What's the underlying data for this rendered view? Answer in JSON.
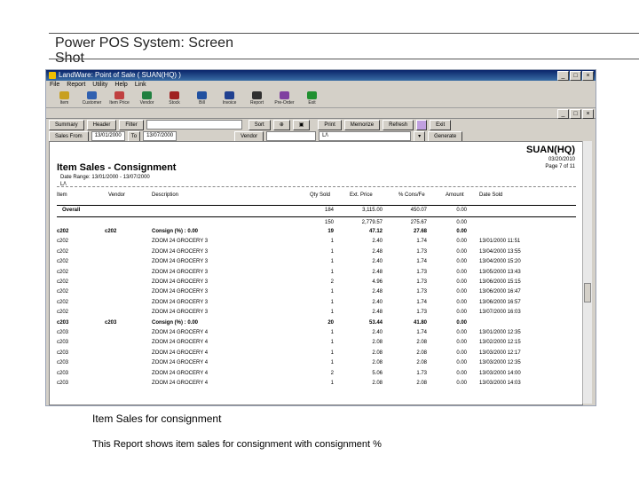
{
  "slide": {
    "title_line1": "Power POS System: Screen",
    "title_line2": "Shot",
    "caption_title": "Item Sales for consignment",
    "caption_desc": "This Report shows item sales for consignment with consignment %"
  },
  "window": {
    "title": "LandWare: Point of Sale ( SUAN(HQ) )",
    "minimize": "_",
    "maximize": "□",
    "close": "×"
  },
  "menu": [
    "File",
    "Report",
    "Utility",
    "Help",
    "Link"
  ],
  "toolbar": [
    {
      "label": "Item",
      "color": "#c8a020"
    },
    {
      "label": "Customer",
      "color": "#3060b0"
    },
    {
      "label": "Item Price",
      "color": "#c04040"
    },
    {
      "label": "Vendor",
      "color": "#208040"
    },
    {
      "label": "Stock",
      "color": "#a02020"
    },
    {
      "label": "Bill",
      "color": "#2050a0"
    },
    {
      "label": "Invoice",
      "color": "#204090"
    },
    {
      "label": "Report",
      "color": "#303030"
    },
    {
      "label": "Pre-Order",
      "color": "#8040a0"
    },
    {
      "label": "Exit",
      "color": "#209030"
    }
  ],
  "controls": {
    "summary": "Summary",
    "header": "Header",
    "filter": "Filter",
    "sort": "Sort",
    "print": "Print",
    "memorize": "Memorize",
    "refresh": "Refresh",
    "exit": "Exit",
    "sales_from_label": "Sales From",
    "date_from": "13/01/2000",
    "to_label": "To",
    "date_to": "13/07/2000",
    "vendor_label": "Vendor",
    "location": "L/\\",
    "generate": "Generate"
  },
  "report": {
    "title": "Item Sales - Consignment",
    "date_range": "Date Range: 13/01/2000 - 13/07/2000",
    "location": "L/\\",
    "store": "SUAN(HQ)",
    "print_date": "03/20/2010",
    "page": "Page 7 of 11",
    "headers": {
      "item": "Item",
      "vendor": "Vendor",
      "description": "Description",
      "qty": "Qty Sold",
      "price": "Ext. Price",
      "cons": "% Cons/Fe",
      "amount": "Amount",
      "date": "Date Sold"
    },
    "overall": {
      "label": "Overall",
      "qty": "184",
      "price": "3,115.00",
      "cons": "450.07",
      "amount": "0.00"
    },
    "subtotal": {
      "qty": "150",
      "price": "2,779.57",
      "cons": "275.67",
      "amount": "0.00"
    },
    "rows": [
      {
        "item": "c202",
        "vendor": "c202",
        "desc": "Consign (%) : 0.00",
        "qty": "19",
        "price": "47.12",
        "cons": "27.68",
        "amount": "0.00",
        "date": "",
        "bold": true
      },
      {
        "item": "c202",
        "vendor": "",
        "desc": "ZOOM 24 GROCERY 3",
        "qty": "1",
        "price": "2.40",
        "cons": "1.74",
        "amount": "0.00",
        "date": "13/01/2000 11:51"
      },
      {
        "item": "c202",
        "vendor": "",
        "desc": "ZOOM 24 GROCERY 3",
        "qty": "1",
        "price": "2.48",
        "cons": "1.73",
        "amount": "0.00",
        "date": "13/04/2000 13:55"
      },
      {
        "item": "c202",
        "vendor": "",
        "desc": "ZOOM 24 GROCERY 3",
        "qty": "1",
        "price": "2.40",
        "cons": "1.74",
        "amount": "0.00",
        "date": "13/04/2000 15:20"
      },
      {
        "item": "c202",
        "vendor": "",
        "desc": "ZOOM 24 GROCERY 3",
        "qty": "1",
        "price": "2.48",
        "cons": "1.73",
        "amount": "0.00",
        "date": "13/05/2000 13:43"
      },
      {
        "item": "c202",
        "vendor": "",
        "desc": "ZOOM 24 GROCERY 3",
        "qty": "2",
        "price": "4.96",
        "cons": "1.73",
        "amount": "0.00",
        "date": "13/06/2000 15:15"
      },
      {
        "item": "c202",
        "vendor": "",
        "desc": "ZOOM 24 GROCERY 3",
        "qty": "1",
        "price": "2.48",
        "cons": "1.73",
        "amount": "0.00",
        "date": "13/06/2000 16:47"
      },
      {
        "item": "c202",
        "vendor": "",
        "desc": "ZOOM 24 GROCERY 3",
        "qty": "1",
        "price": "2.40",
        "cons": "1.74",
        "amount": "0.00",
        "date": "13/06/2000 16:57"
      },
      {
        "item": "c202",
        "vendor": "",
        "desc": "ZOOM 24 GROCERY 3",
        "qty": "1",
        "price": "2.48",
        "cons": "1.73",
        "amount": "0.00",
        "date": "13/07/2000 16:03"
      },
      {
        "item": "c203",
        "vendor": "c203",
        "desc": "Consign (%) : 0.00",
        "qty": "20",
        "price": "53.44",
        "cons": "41.80",
        "amount": "0.00",
        "date": "",
        "bold": true
      },
      {
        "item": "c203",
        "vendor": "",
        "desc": "ZOOM 24 GROCERY 4",
        "qty": "1",
        "price": "2.40",
        "cons": "1.74",
        "amount": "0.00",
        "date": "13/01/2000 12:35"
      },
      {
        "item": "c203",
        "vendor": "",
        "desc": "ZOOM 24 GROCERY 4",
        "qty": "1",
        "price": "2.08",
        "cons": "2.08",
        "amount": "0.00",
        "date": "13/02/2000 12:15"
      },
      {
        "item": "c203",
        "vendor": "",
        "desc": "ZOOM 24 GROCERY 4",
        "qty": "1",
        "price": "2.08",
        "cons": "2.08",
        "amount": "0.00",
        "date": "13/03/2000 12:17"
      },
      {
        "item": "c203",
        "vendor": "",
        "desc": "ZOOM 24 GROCERY 4",
        "qty": "1",
        "price": "2.08",
        "cons": "2.08",
        "amount": "0.00",
        "date": "13/03/2000 12:35"
      },
      {
        "item": "c203",
        "vendor": "",
        "desc": "ZOOM 24 GROCERY 4",
        "qty": "2",
        "price": "5.06",
        "cons": "1.73",
        "amount": "0.00",
        "date": "13/03/2000 14:00"
      },
      {
        "item": "c203",
        "vendor": "",
        "desc": "ZOOM 24 GROCERY 4",
        "qty": "1",
        "price": "2.08",
        "cons": "2.08",
        "amount": "0.00",
        "date": "13/03/2000 14:03"
      }
    ]
  }
}
